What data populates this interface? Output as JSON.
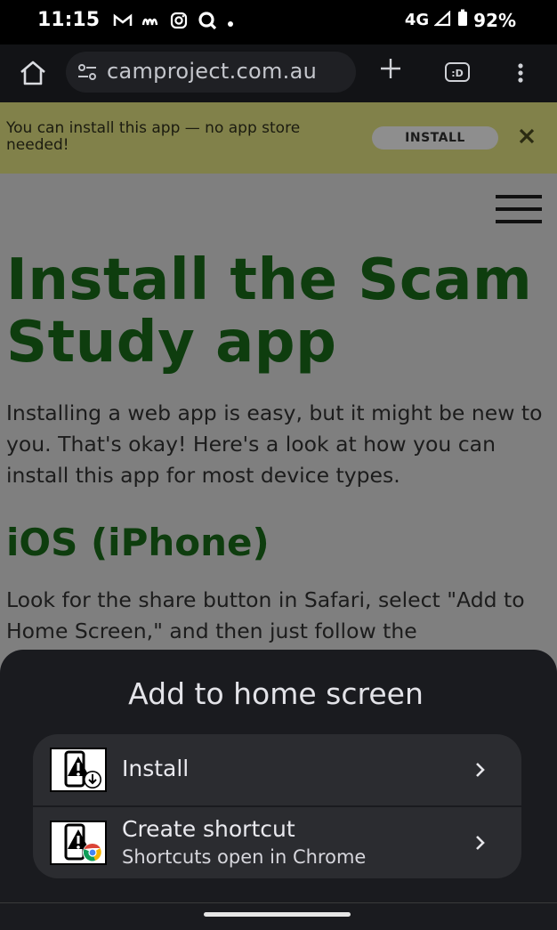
{
  "status_bar": {
    "time": "11:15",
    "notification_icons": [
      "gmail-icon",
      "abc-icon",
      "instagram-icon",
      "q-icon",
      "dot-icon"
    ],
    "network": "4G",
    "battery": "92%"
  },
  "browser": {
    "url": "camproject.com.au",
    "tab_switcher_label": ":D"
  },
  "install_banner": {
    "text": "You can install this app — no app store needed!",
    "button_label": "INSTALL"
  },
  "page": {
    "heading": "Install the Scam Study app",
    "intro": "Installing a web app is easy, but it might be new to you. That's okay! Here's a look at how you can install this app for most device types.",
    "ios_heading": "iOS (iPhone)",
    "ios_text": "Look for the share button in Safari, select \"Add to Home Screen,\" and then just follow the"
  },
  "sheet": {
    "title": "Add to home screen",
    "options": [
      {
        "label": "Install",
        "icon": "app-install-icon"
      },
      {
        "label": "Create shortcut",
        "sublabel": "Shortcuts open in Chrome",
        "icon": "chrome-shortcut-icon"
      }
    ]
  }
}
